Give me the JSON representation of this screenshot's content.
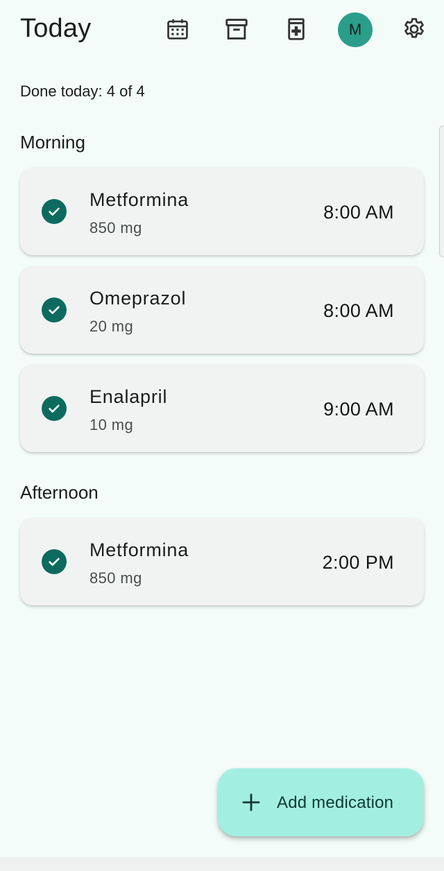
{
  "header": {
    "title": "Today",
    "avatar_initial": "M",
    "icons": [
      "calendar-icon",
      "archive-icon",
      "medical-add-icon",
      "gear-icon"
    ]
  },
  "progress": {
    "text": "Done today: 4 of 4",
    "done": 4,
    "total": 4
  },
  "sections": [
    {
      "title": "Morning",
      "items": [
        {
          "name": "Metformina",
          "dose": "850 mg",
          "time": "8:00 AM",
          "taken": true
        },
        {
          "name": "Omeprazol",
          "dose": "20 mg",
          "time": "8:00 AM",
          "taken": true
        },
        {
          "name": "Enalapril",
          "dose": "10 mg",
          "time": "9:00 AM",
          "taken": true
        }
      ]
    },
    {
      "title": "Afternoon",
      "items": [
        {
          "name": "Metformina",
          "dose": "850 mg",
          "time": "2:00 PM",
          "taken": true
        }
      ]
    }
  ],
  "fab": {
    "label": "Add medication"
  },
  "colors": {
    "background": "#f3fcf9",
    "check": "#0c6b5e",
    "avatar": "#2b9e8b",
    "fab": "#a2efe1",
    "card": "#f1f3f2"
  }
}
